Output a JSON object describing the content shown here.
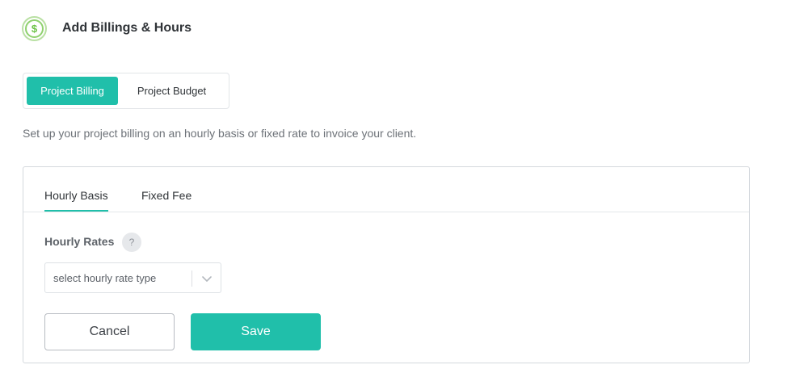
{
  "header": {
    "title": "Add Billings & Hours",
    "icon": "dollar-circle-icon"
  },
  "billing_switch": {
    "options": [
      {
        "label": "Project Billing",
        "active": true
      },
      {
        "label": "Project Budget",
        "active": false
      }
    ]
  },
  "description": "Set up your project billing on an hourly basis or fixed rate to invoice your client.",
  "card": {
    "tabs": [
      {
        "label": "Hourly Basis",
        "active": true
      },
      {
        "label": "Fixed Fee",
        "active": false
      }
    ],
    "hourly_rates": {
      "label": "Hourly Rates",
      "help": "?",
      "select_placeholder": "select hourly rate type"
    },
    "buttons": {
      "cancel": "Cancel",
      "save": "Save"
    }
  },
  "colors": {
    "accent": "#20bfaa",
    "icon_green": "#6bc245"
  }
}
